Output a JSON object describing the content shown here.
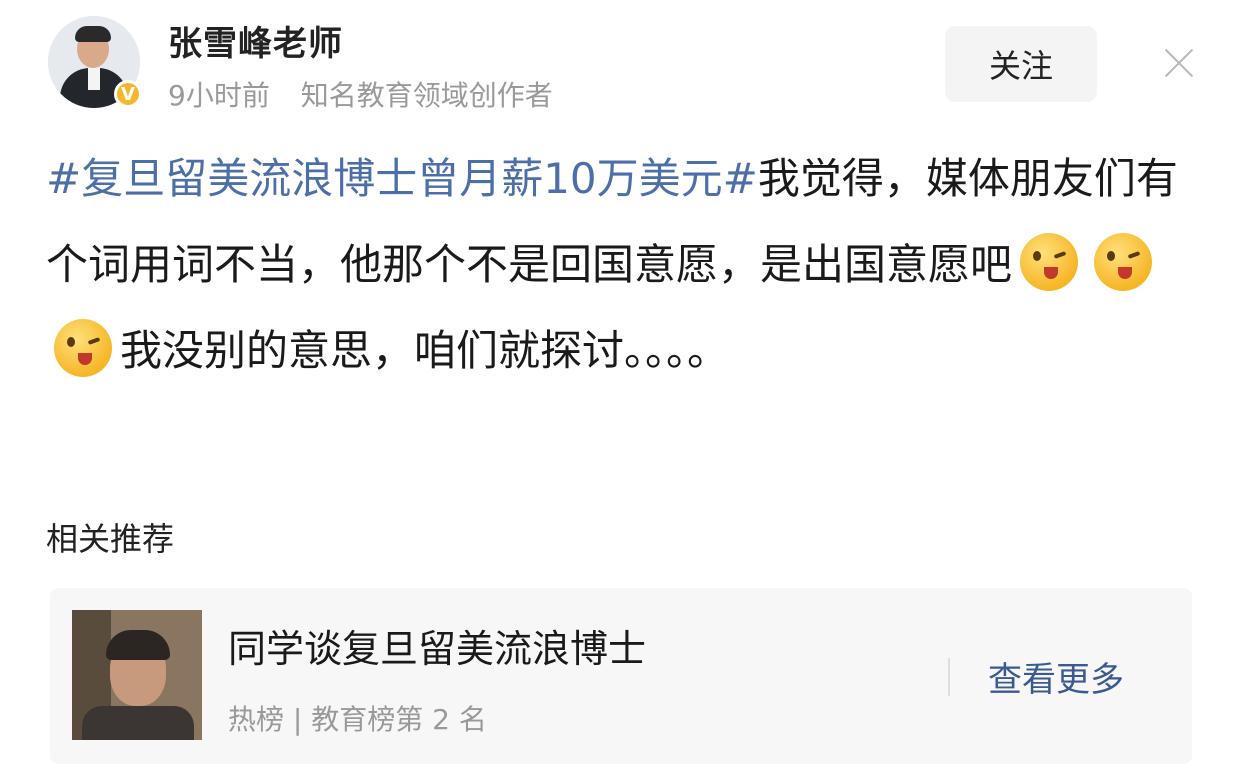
{
  "header": {
    "username": "张雪峰老师",
    "time_ago": "9小时前",
    "description": "知名教育领域创作者",
    "follow_label": "关注",
    "verified_badge": "V"
  },
  "post": {
    "hashtag": "#复旦留美流浪博士曾月薪10万美元#",
    "text_part1": "我觉得，媒体朋友们有个词用词不当，他那个不是回国意愿，是出国意愿吧",
    "text_part2": "我没别的意思，咱们就探讨。。。。",
    "emoji_names": [
      "wink-tongue-emoji",
      "wink-tongue-emoji",
      "wink-tongue-emoji"
    ]
  },
  "recommendation": {
    "section_title": "相关推荐",
    "headline": "同学谈复旦留美流浪博士",
    "subtitle": "热榜 | 教育榜第 2 名",
    "more_label": "查看更多"
  },
  "colors": {
    "hashtag": "#4d6fa8",
    "more_link": "#3b5a90",
    "badge": "#f5b72a"
  }
}
